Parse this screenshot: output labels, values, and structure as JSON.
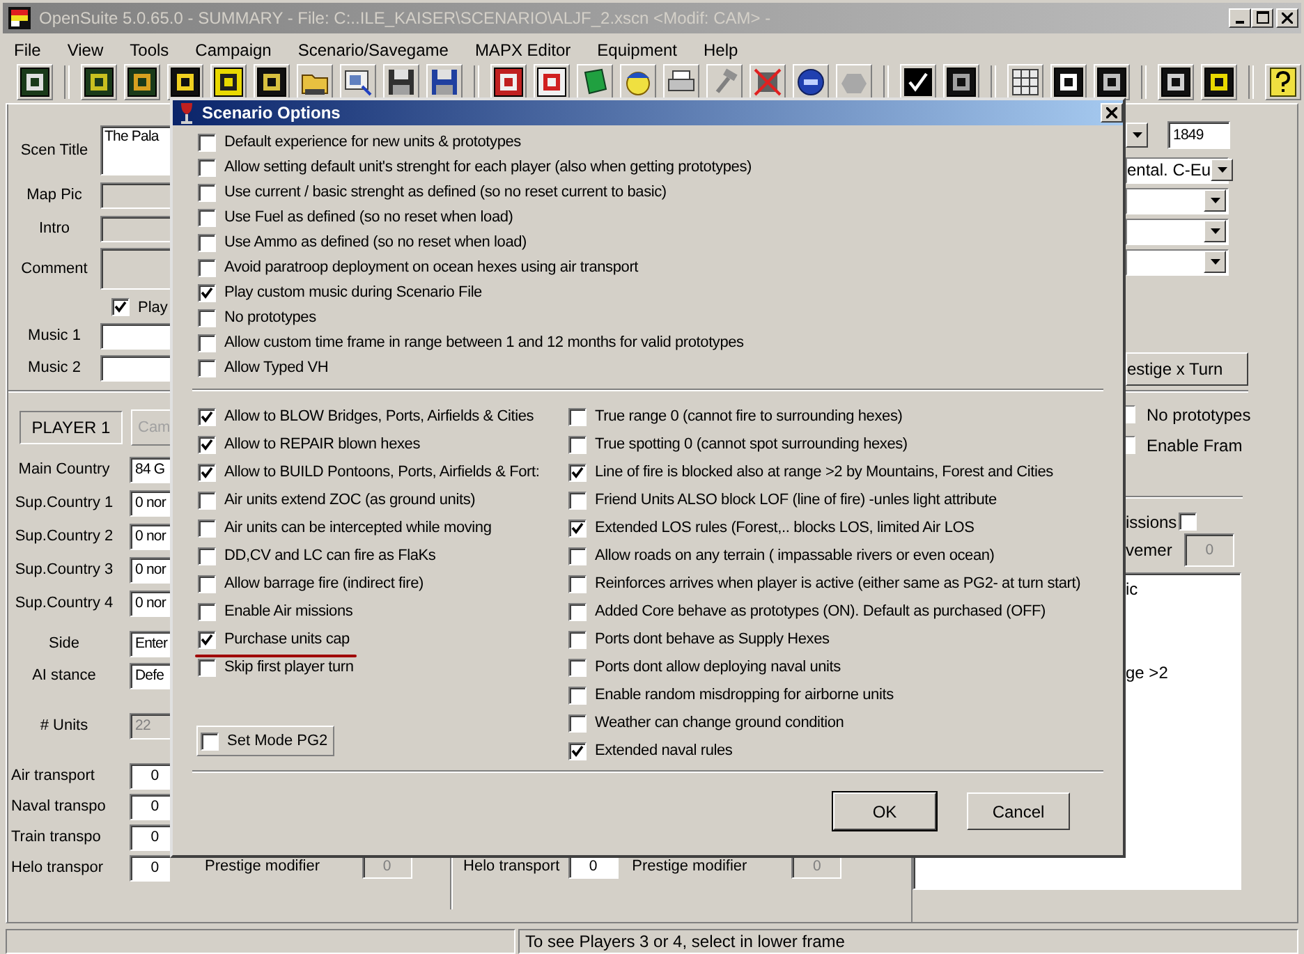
{
  "window": {
    "title": "OpenSuite  5.0.65.0 - SUMMARY - File: C:..ILE_KAISER\\SCENARIO\\ALJF_2.xscn <Modif: CAM>  -"
  },
  "menu": [
    "File",
    "View",
    "Tools",
    "Campaign",
    "Scenario/Savegame",
    "MAPX Editor",
    "Equipment",
    "Help"
  ],
  "scenario": {
    "fields": [
      {
        "label": "Scen Title",
        "value": "The Pala",
        "kind": "tall"
      },
      {
        "label": "Map Pic",
        "kind": "disabled"
      },
      {
        "label": "Intro",
        "kind": "disabled"
      },
      {
        "label": "Comment",
        "kind": "comment"
      }
    ],
    "play_music": {
      "label": "Play",
      "checked": true
    },
    "music": [
      {
        "label": "Music 1"
      },
      {
        "label": "Music 2"
      }
    ]
  },
  "player": {
    "tab": "PLAYER 1",
    "button": "Cam",
    "countries": [
      {
        "label": "Main Country",
        "value": "84 G"
      },
      {
        "label": "Sup.Country 1",
        "value": "0 nor"
      },
      {
        "label": "Sup.Country 2",
        "value": "0 nor"
      },
      {
        "label": "Sup.Country 3",
        "value": "0 nor"
      },
      {
        "label": "Sup.Country 4",
        "value": "0 nor"
      }
    ],
    "side": {
      "label": "Side",
      "value": "Enter"
    },
    "ai_stance": {
      "label": "AI stance",
      "value": "Defe"
    },
    "units": {
      "label": "# Units",
      "value": "22",
      "disabled": true
    },
    "transports": [
      {
        "label": "Air transport",
        "value": "0"
      },
      {
        "label": "Naval transpo",
        "value": "0"
      },
      {
        "label": "Train  transpo",
        "value": "0"
      },
      {
        "label": "Helo  transpor",
        "value": "0"
      }
    ],
    "prestige_modifier": {
      "label": "Prestige modifier",
      "value": "0",
      "disabled": true
    }
  },
  "player_2": {
    "helo_transport": {
      "label": "Helo  transport",
      "value": "0"
    },
    "prestige_modifier": {
      "label": "Prestige modifier",
      "value": "0",
      "disabled": true
    }
  },
  "settings": {
    "year": "1849",
    "region": "ental. C-Eu",
    "prestige_button": "estige x Turn",
    "options": [
      {
        "label": "No prototypes",
        "checked": false
      },
      {
        "label": "Enable Fram",
        "checked": false
      }
    ],
    "air_missions": {
      "label": "issions",
      "checked": false
    },
    "movement": {
      "label": "vemer",
      "value": "0",
      "disabled": true
    },
    "notes": [
      "ic",
      "ge >2"
    ]
  },
  "dialog": {
    "title": "Scenario Options",
    "general_options": [
      {
        "label": "Default experience for new units & prototypes",
        "checked": false
      },
      {
        "label": "Allow setting default unit's strenght for each player (also when getting prototypes)",
        "checked": false
      },
      {
        "label": "Use current / basic strenght as defined (so no reset current to basic)",
        "checked": false
      },
      {
        "label": "Use Fuel as defined (so no reset when load)",
        "checked": false
      },
      {
        "label": "Use Ammo as defined (so no reset when load)",
        "checked": false
      },
      {
        "label": "Avoid paratroop deployment on ocean hexes using air transport",
        "checked": false
      },
      {
        "label": "Play custom music during Scenario File",
        "checked": true
      },
      {
        "label": "No prototypes",
        "checked": false
      },
      {
        "label": "Allow custom time frame in range between 1 and 12 months for valid prototypes",
        "checked": false
      },
      {
        "label": "Allow Typed VH",
        "checked": false
      }
    ],
    "left_options": [
      {
        "label": "Allow to BLOW Bridges, Ports, Airfields & Cities",
        "checked": true,
        "highlighted": false
      },
      {
        "label": "Allow to REPAIR blown hexes",
        "checked": true,
        "highlighted": false
      },
      {
        "label": "Allow to BUILD Pontoons, Ports, Airfields & Fort:",
        "checked": true,
        "highlighted": false
      },
      {
        "label": "Air units extend ZOC (as ground units)",
        "checked": false,
        "highlighted": false
      },
      {
        "label": "Air units can be intercepted while moving",
        "checked": false,
        "highlighted": false
      },
      {
        "label": "DD,CV and LC can fire as FlaKs",
        "checked": false,
        "highlighted": false
      },
      {
        "label": "Allow barrage fire (indirect fire)",
        "checked": false,
        "highlighted": false
      },
      {
        "label": "Enable Air missions",
        "checked": false,
        "highlighted": false
      },
      {
        "label": "Purchase units cap",
        "checked": true,
        "highlighted": true
      },
      {
        "label": "Skip first player turn",
        "checked": false,
        "highlighted": false
      }
    ],
    "right_options": [
      {
        "label": "True range 0 (cannot fire to surrounding hexes)",
        "checked": false
      },
      {
        "label": "True spotting 0 (cannot spot surrounding hexes)",
        "checked": false
      },
      {
        "label": "Line of fire is blocked also at range >2 by Mountains, Forest and Cities",
        "checked": true
      },
      {
        "label": "Friend Units ALSO block LOF (line of fire) -unles light attribute",
        "checked": false
      },
      {
        "label": "Extended LOS rules (Forest,.. blocks LOS, limited Air LOS",
        "checked": true
      },
      {
        "label": "Allow roads on any terrain ( impassable rivers or even ocean)",
        "checked": false
      },
      {
        "label": "Reinforces arrives when player is active (either same as PG2- at turn start)",
        "checked": false
      },
      {
        "label": "Added Core behave as prototypes (ON). Default as purchased (OFF)",
        "checked": false
      },
      {
        "label": "Ports dont behave as Supply Hexes",
        "checked": false
      },
      {
        "label": "Ports dont allow deploying naval units",
        "checked": false
      },
      {
        "label": "Enable random misdropping for airborne units",
        "checked": false
      },
      {
        "label": "Weather can change ground condition",
        "checked": false
      },
      {
        "label": "Extended naval rules",
        "checked": true
      }
    ],
    "set_mode_pg2": {
      "label": "Set Mode PG2",
      "checked": false
    },
    "buttons": [
      "OK",
      "Cancel"
    ]
  },
  "status_bar": {
    "message": "To see Players 3 or 4, select in lower frame"
  }
}
